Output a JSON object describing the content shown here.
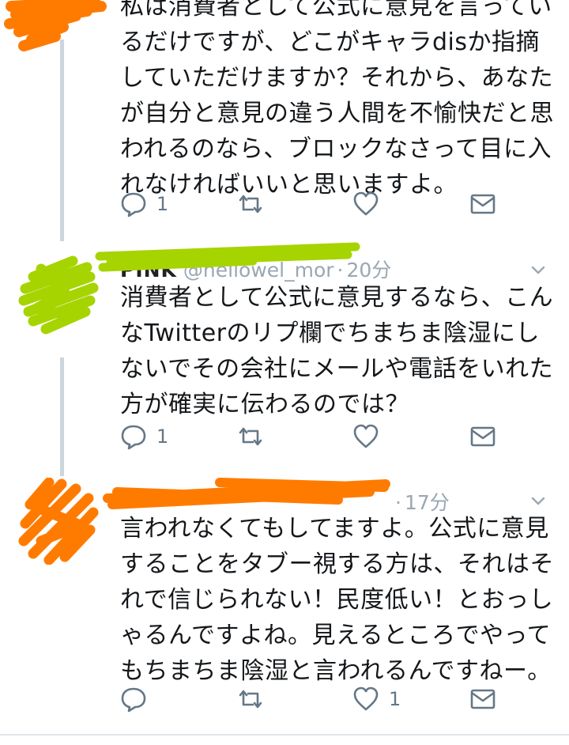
{
  "tweets": [
    {
      "name": "",
      "handle": "",
      "time": "",
      "text": "私は消費者として公式に意見を言っているだけですが、どこがキャラdisか指摘していただけますか？それから、あなたが自分と意見の違う人間を不愉快だと思われるのなら、ブロックなさって目に入れなければいいと思いますよ。",
      "reply_count": "1",
      "like_count": ""
    },
    {
      "name": "PINK",
      "handle": "@hellowel_mor",
      "time": "20分",
      "text": "消費者として公式に意見するなら、こんなTwitterのリプ欄でちまちま陰湿にしないでその会社にメールや電話をいれた方が確実に伝わるのでは？",
      "reply_count": "1",
      "like_count": ""
    },
    {
      "name": "",
      "handle": "",
      "time": "17分",
      "text": "言われなくてもしてますよ。公式に意見することをタブー視する方は、それはそれで信じられない！民度低い！とおっしゃるんですよね。見えるところでやってもちまちま陰湿と言われるんですねー。",
      "reply_count": "",
      "like_count": "1"
    }
  ],
  "colors": {
    "scribble_orange": "#ff7b00",
    "scribble_green": "#a6d400",
    "icon_gray": "#657786",
    "thread_line": "#cdd6dd"
  },
  "icons": [
    "reply-icon",
    "retweet-icon",
    "like-icon",
    "message-icon",
    "chevron-down-icon"
  ]
}
